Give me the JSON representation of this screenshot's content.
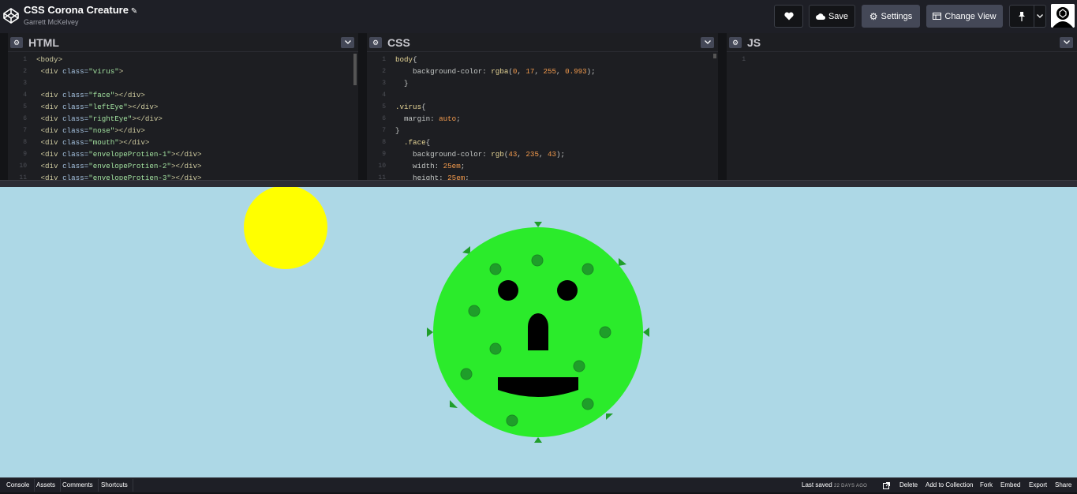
{
  "header": {
    "title": "CSS Corona Creature",
    "author": "Garrett McKelvey",
    "save_label": "Save",
    "settings_label": "Settings",
    "change_view_label": "Change View"
  },
  "editors": {
    "html": {
      "name": "HTML",
      "lines": [
        {
          "n": "1",
          "parts": [
            [
              "tag",
              "<body>"
            ]
          ]
        },
        {
          "n": "2",
          "parts": [
            [
              "txt",
              " "
            ],
            [
              "tag",
              "<div"
            ],
            [
              "attr",
              " class="
            ],
            [
              "str",
              "\"virus\""
            ],
            [
              "tag",
              ">"
            ]
          ]
        },
        {
          "n": "3",
          "parts": [
            [
              "txt",
              ""
            ]
          ]
        },
        {
          "n": "4",
          "parts": [
            [
              "txt",
              " "
            ],
            [
              "tag",
              "<div"
            ],
            [
              "attr",
              " class="
            ],
            [
              "str",
              "\"face\""
            ],
            [
              "tag",
              "></div>"
            ]
          ]
        },
        {
          "n": "5",
          "parts": [
            [
              "txt",
              " "
            ],
            [
              "tag",
              "<div"
            ],
            [
              "attr",
              " class="
            ],
            [
              "str",
              "\"leftEye\""
            ],
            [
              "tag",
              "></div>"
            ]
          ]
        },
        {
          "n": "6",
          "parts": [
            [
              "txt",
              " "
            ],
            [
              "tag",
              "<div"
            ],
            [
              "attr",
              " class="
            ],
            [
              "str",
              "\"rightEye\""
            ],
            [
              "tag",
              "></div>"
            ]
          ]
        },
        {
          "n": "7",
          "parts": [
            [
              "txt",
              " "
            ],
            [
              "tag",
              "<div"
            ],
            [
              "attr",
              " class="
            ],
            [
              "str",
              "\"nose\""
            ],
            [
              "tag",
              "></div>"
            ]
          ]
        },
        {
          "n": "8",
          "parts": [
            [
              "txt",
              " "
            ],
            [
              "tag",
              "<div"
            ],
            [
              "attr",
              " class="
            ],
            [
              "str",
              "\"mouth\""
            ],
            [
              "tag",
              "></div>"
            ]
          ]
        },
        {
          "n": "9",
          "parts": [
            [
              "txt",
              " "
            ],
            [
              "tag",
              "<div"
            ],
            [
              "attr",
              " class="
            ],
            [
              "str",
              "\"envelopeProtien-1\""
            ],
            [
              "tag",
              "></div>"
            ]
          ]
        },
        {
          "n": "10",
          "parts": [
            [
              "txt",
              " "
            ],
            [
              "tag",
              "<div"
            ],
            [
              "attr",
              " class="
            ],
            [
              "str",
              "\"envelopeProtien-2\""
            ],
            [
              "tag",
              "></div>"
            ]
          ]
        },
        {
          "n": "11",
          "parts": [
            [
              "txt",
              " "
            ],
            [
              "tag",
              "<div"
            ],
            [
              "attr",
              " class="
            ],
            [
              "str",
              "\"envelopeProtien-3\""
            ],
            [
              "tag",
              "></div>"
            ]
          ]
        }
      ]
    },
    "css": {
      "name": "CSS",
      "lines": [
        {
          "n": "1",
          "parts": [
            [
              "sel",
              "body"
            ],
            [
              "txt",
              "{"
            ]
          ]
        },
        {
          "n": "2",
          "parts": [
            [
              "prop",
              "    background-color: "
            ],
            [
              "sel",
              "rgba"
            ],
            [
              "txt",
              "("
            ],
            [
              "num",
              "0"
            ],
            [
              "txt",
              ", "
            ],
            [
              "num",
              "17"
            ],
            [
              "txt",
              ", "
            ],
            [
              "num",
              "255"
            ],
            [
              "txt",
              ", "
            ],
            [
              "num",
              "0.993"
            ],
            [
              "txt",
              ");"
            ]
          ]
        },
        {
          "n": "3",
          "parts": [
            [
              "txt",
              "  }"
            ]
          ]
        },
        {
          "n": "4",
          "parts": [
            [
              "txt",
              ""
            ]
          ]
        },
        {
          "n": "5",
          "parts": [
            [
              "sel",
              ".virus"
            ],
            [
              "txt",
              "{"
            ]
          ]
        },
        {
          "n": "6",
          "parts": [
            [
              "prop",
              "  margin: "
            ],
            [
              "val",
              "auto"
            ],
            [
              "txt",
              ";"
            ]
          ]
        },
        {
          "n": "7",
          "parts": [
            [
              "txt",
              "}"
            ]
          ]
        },
        {
          "n": "8",
          "parts": [
            [
              "sel",
              "  .face"
            ],
            [
              "txt",
              "{"
            ]
          ]
        },
        {
          "n": "9",
          "parts": [
            [
              "prop",
              "    background-color: "
            ],
            [
              "sel",
              "rgb"
            ],
            [
              "txt",
              "("
            ],
            [
              "num",
              "43"
            ],
            [
              "txt",
              ", "
            ],
            [
              "num",
              "235"
            ],
            [
              "txt",
              ", "
            ],
            [
              "num",
              "43"
            ],
            [
              "txt",
              ");"
            ]
          ]
        },
        {
          "n": "10",
          "parts": [
            [
              "prop",
              "    width: "
            ],
            [
              "num",
              "25em"
            ],
            [
              "txt",
              ";"
            ]
          ]
        },
        {
          "n": "11",
          "parts": [
            [
              "prop",
              "    height: "
            ],
            [
              "num",
              "25em"
            ],
            [
              "txt",
              ";"
            ]
          ]
        }
      ]
    },
    "js": {
      "name": "JS",
      "lines": [
        {
          "n": "1",
          "parts": [
            [
              "txt",
              ""
            ]
          ]
        }
      ]
    }
  },
  "footer": {
    "console": "Console",
    "assets": "Assets",
    "comments": "Comments",
    "shortcuts": "Shortcuts",
    "last_saved": "Last saved",
    "last_saved_when": "22 DAYS AGO",
    "delete": "Delete",
    "add_to_collection": "Add to Collection",
    "fork": "Fork",
    "embed": "Embed",
    "export": "Export",
    "share": "Share"
  },
  "icons": {
    "logo": "codepen-logo-icon",
    "heart": "heart-icon",
    "cloud": "cloud-icon",
    "gear": "gear-icon",
    "view": "layout-icon",
    "pin": "pin-icon",
    "chevron": "chevron-down-icon"
  },
  "colors": {
    "preview_bg": "#add8e6",
    "face": "#2beb2b",
    "sun": "#ffff00",
    "protein": "#1f9e2a"
  }
}
